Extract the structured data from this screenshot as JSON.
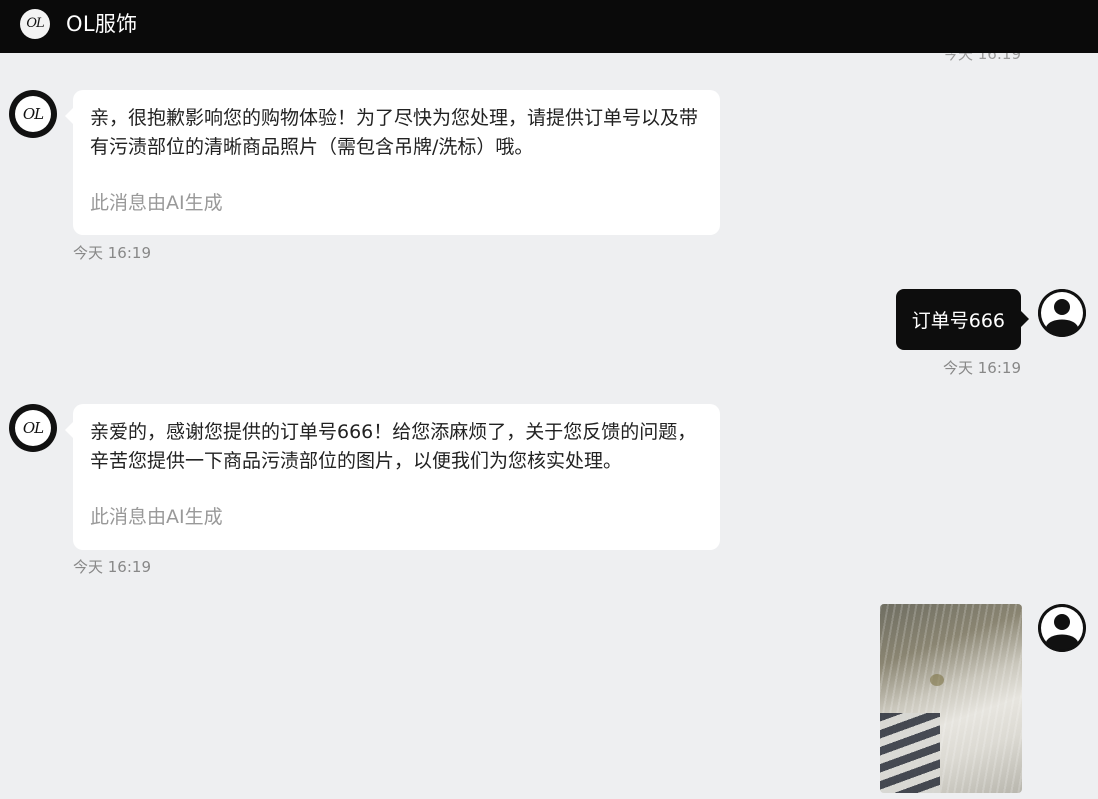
{
  "header": {
    "logo_text": "OL",
    "title": "OL服饰"
  },
  "chat": {
    "ghost_time": "今天 16:19",
    "messages": [
      {
        "side": "in",
        "text_line1": "亲，很抱歉影响您的购物体验！为了尽快为您处理，请提供订单号以及带",
        "text_line2": "有污渍部位的清晰商品照片（需包含吊牌/洗标）哦。",
        "ai_note": "此消息由AI生成",
        "time": "今天 16:19"
      },
      {
        "side": "out",
        "text": "订单号666",
        "time": "今天 16:19"
      },
      {
        "side": "in",
        "text_line1": "亲爱的，感谢您提供的订单号666！给您添麻烦了，关于您反馈的问题，",
        "text_line2": "辛苦您提供一下商品污渍部位的图片，以便我们为您核实处理。",
        "ai_note": "此消息由AI生成",
        "time": "今天 16:19"
      },
      {
        "side": "out",
        "type": "image"
      }
    ],
    "avatar_text": "OL"
  },
  "colors": {
    "header_bg": "#0a0a0a",
    "chat_bg": "#eeeff1",
    "bubble_in": "#ffffff",
    "bubble_out": "#0d0d0d",
    "ai_note": "#999999"
  }
}
